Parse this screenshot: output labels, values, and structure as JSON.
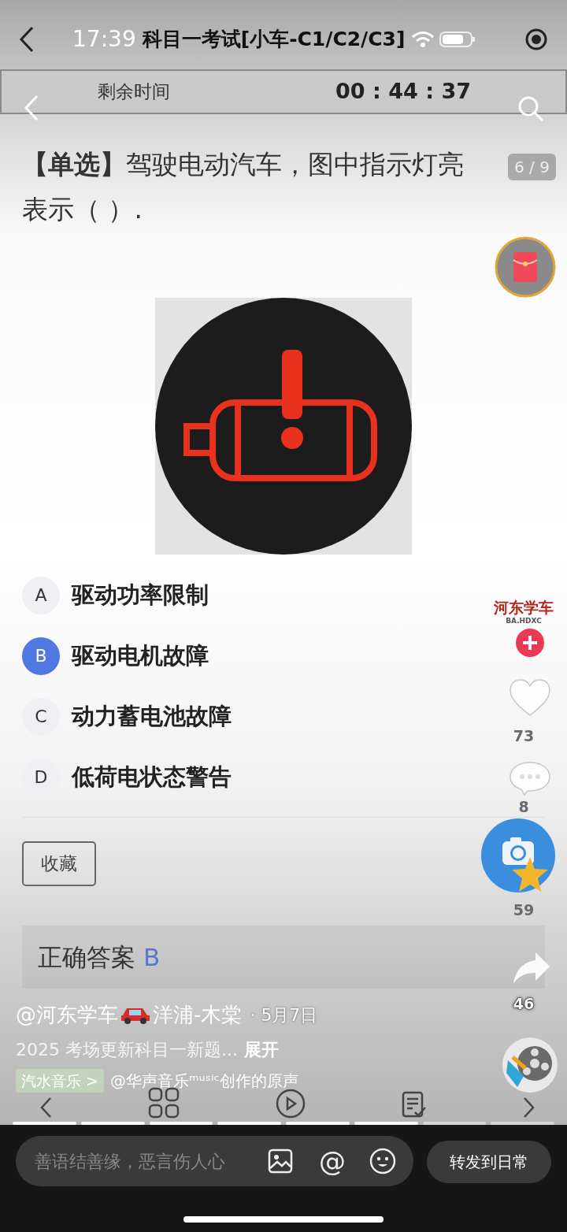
{
  "status_bar": {
    "time": "17:39"
  },
  "header": {
    "title": "科目一考试[小车-C1/C2/C3]"
  },
  "timer": {
    "label": "剩余时间",
    "value": "00 : 44 : 37"
  },
  "question": {
    "text": "**【单选】**驾驶电动汽车，图中指示灯亮表示（ ）.",
    "counter": "6 / 9"
  },
  "options": [
    {
      "letter": "A",
      "text": "驱动功率限制",
      "selected": false
    },
    {
      "letter": "B",
      "text": "驱动电机故障",
      "selected": true
    },
    {
      "letter": "C",
      "text": "动力蓄电池故障",
      "selected": false
    },
    {
      "letter": "D",
      "text": "低荷电状态警告",
      "selected": false
    }
  ],
  "favorite_button": "收藏",
  "answer": {
    "label": "正确答案",
    "value": "B"
  },
  "rail": {
    "logo": "河东学车",
    "logo_sub": "BA.HDXC",
    "likes": "73",
    "comments": "8",
    "favorites": "59",
    "shares": "46"
  },
  "post": {
    "author": "@河东学车",
    "author_suffix": "洋浦-木棠",
    "date": "· 5月7日",
    "description": "2025 考场更新科目一新题...",
    "expand": "展开",
    "music_tag": "汽水音乐 >",
    "music": "@华声音乐ᵐᵘˢⁱᶜ创作的原声"
  },
  "progress_segments": [
    {
      "watched": true
    },
    {
      "watched": true
    },
    {
      "watched": true
    },
    {
      "watched": true
    },
    {
      "watched": true
    },
    {
      "watched": true
    },
    {
      "watched": false
    },
    {
      "watched": false
    }
  ],
  "comment_bar": {
    "placeholder": "善语结善缘，恶言伤人心",
    "mention": "@",
    "forward": "转发到日常"
  }
}
